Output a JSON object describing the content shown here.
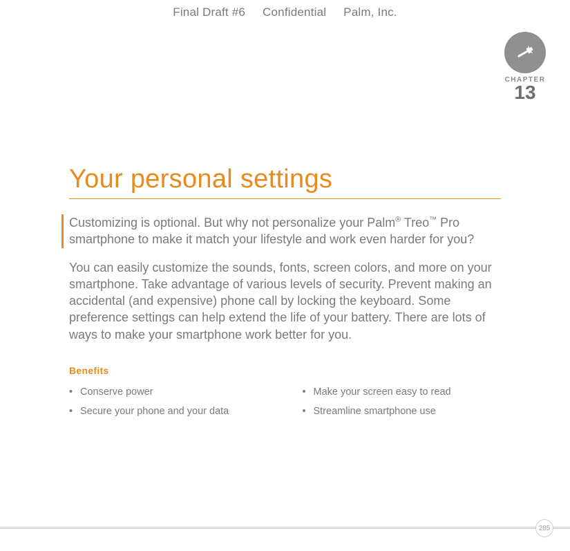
{
  "header": {
    "draft": "Final Draft #6",
    "confidential": "Confidential",
    "company": "Palm, Inc."
  },
  "chapter": {
    "label": "CHAPTER",
    "number": "13",
    "title": "Your personal settings"
  },
  "intro": {
    "para1_a": "Customizing is optional. But why not personalize your Palm",
    "reg": "®",
    "para1_b": " Treo",
    "tm": "™",
    "para1_c": " Pro smartphone to make it match your lifestyle and work even harder for you?",
    "para2": "You can easily customize the sounds, fonts, screen colors, and more on your smartphone. Take advantage of various levels of security. Prevent making an accidental (and expensive) phone call by locking the keyboard. Some preference settings can help extend the life of your battery. There are lots of ways to make your smartphone work better for you."
  },
  "benefits": {
    "heading": "Benefits",
    "col1": [
      "Conserve power",
      "Secure your phone and your data"
    ],
    "col2": [
      "Make your screen easy to read",
      "Streamline smartphone use"
    ]
  },
  "page_number": "285"
}
